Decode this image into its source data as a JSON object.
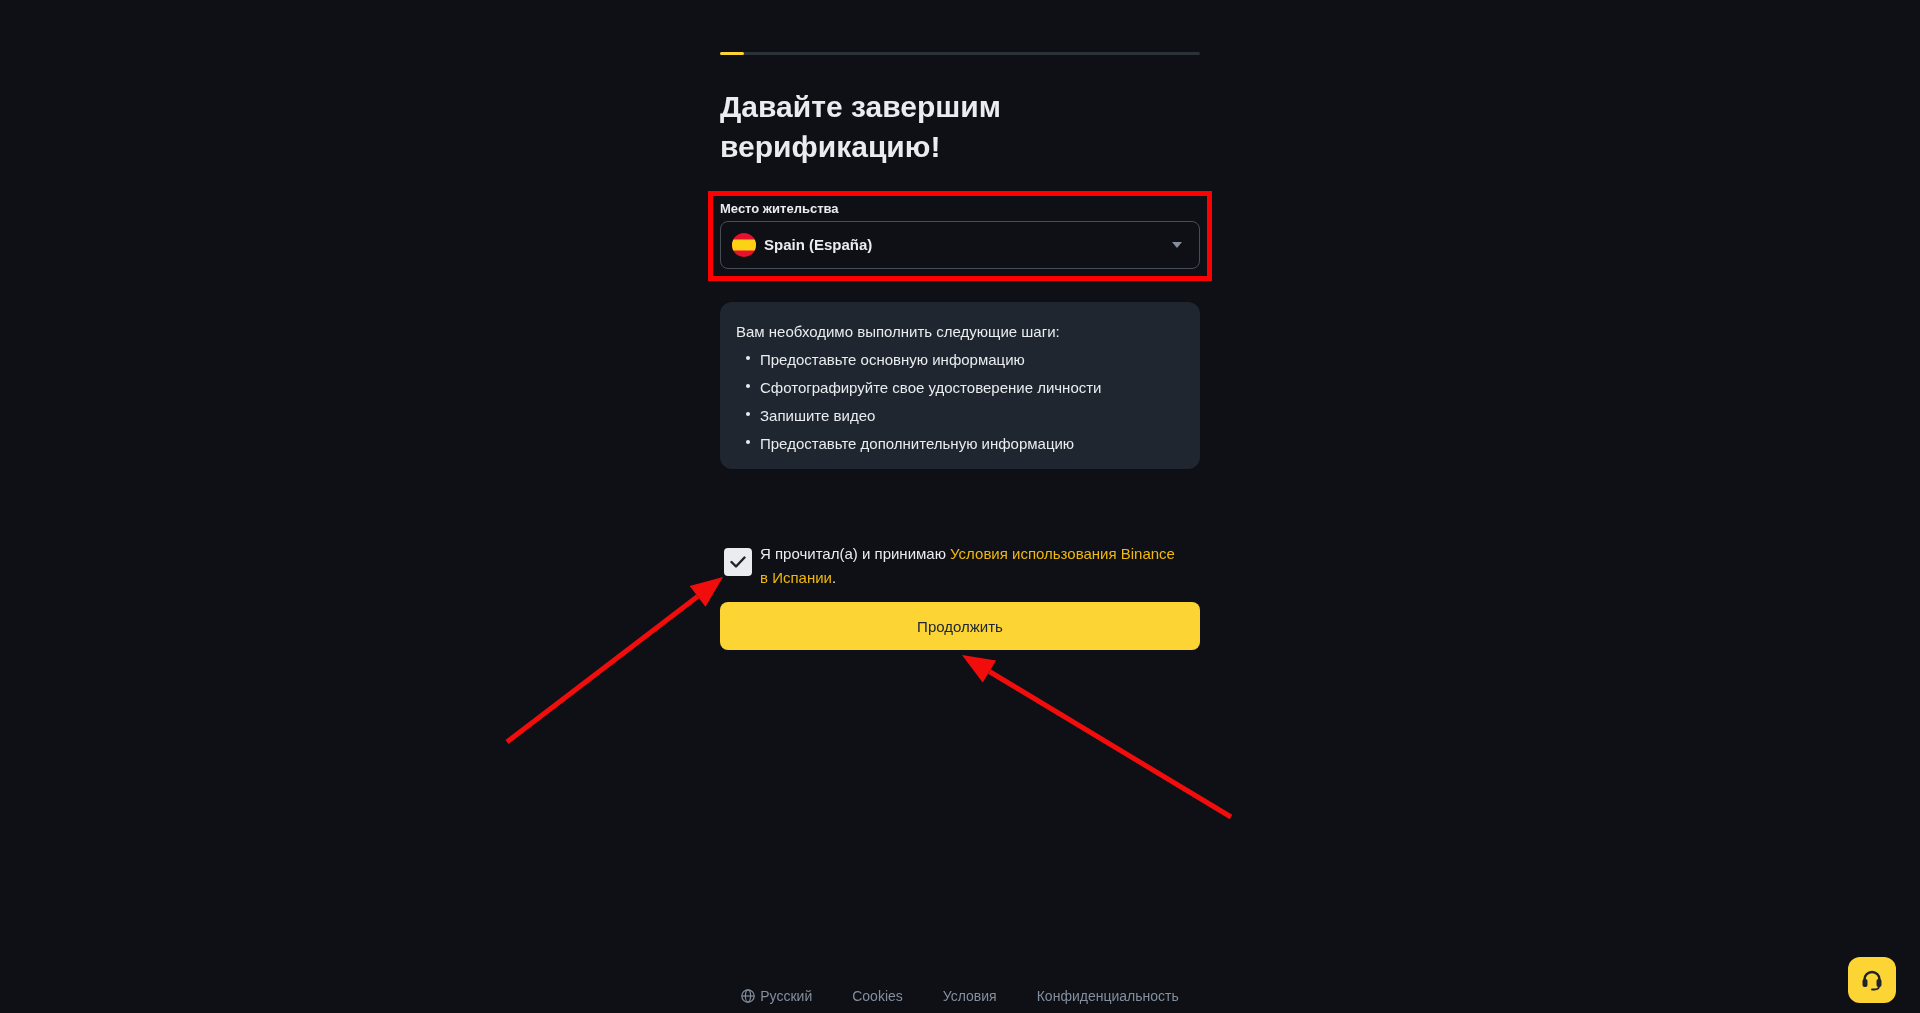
{
  "progress": {
    "level": 0.05
  },
  "title": "Давайте завершим верификацию!",
  "residence": {
    "label": "Место жительства",
    "value": "Spain (España)"
  },
  "steps": {
    "heading": "Вам необходимо выполнить следующие шаги:",
    "items": [
      "Предоставьте основную информацию",
      "Сфотографируйте свое удостоверение личности",
      "Запишите видео",
      "Предоставьте дополнительную информацию"
    ]
  },
  "agreement": {
    "checked": true,
    "text": "Я прочитал(а) и принимаю",
    "link_parts": [
      "Условия использования Binance",
      "в Испании"
    ],
    "text_end": "."
  },
  "continue_button": "Продолжить",
  "footer": {
    "language": "Русский",
    "links": [
      "Cookies",
      "Условия",
      "Конфиденциальность"
    ]
  }
}
